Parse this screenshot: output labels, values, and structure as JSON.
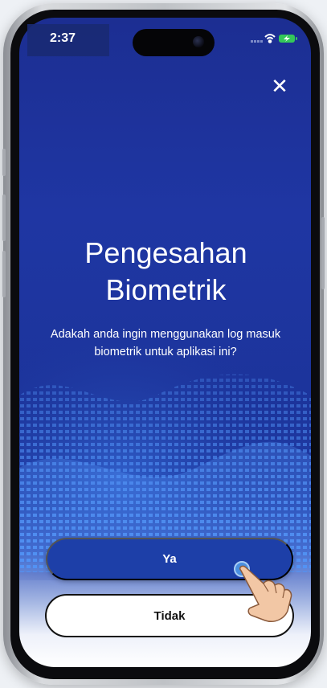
{
  "status_bar": {
    "time": "2:37"
  },
  "dialog": {
    "close_icon": "close-icon",
    "title_line1": "Pengesahan",
    "title_line2": "Biometrik",
    "message": "Adakah anda ingin menggunakan log masuk biometrik untuk aplikasi ini?",
    "confirm_label": "Ya",
    "decline_label": "Tidak"
  },
  "colors": {
    "background_primary": "#1c2e92",
    "button_primary": "#1d3fa8",
    "button_secondary_bg": "#ffffff",
    "text_light": "#ffffff",
    "text_dark": "#111111"
  }
}
